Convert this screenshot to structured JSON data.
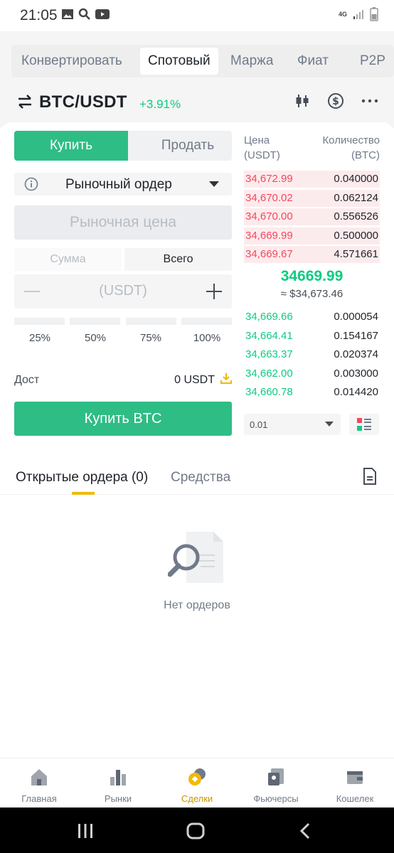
{
  "status_bar": {
    "time": "21:05",
    "network": "4G"
  },
  "top_tabs": [
    "Конвертировать",
    "Спотовый",
    "Маржа",
    "Фиат",
    "P2P"
  ],
  "pair": {
    "name": "BTC/USDT",
    "change": "+3.91%"
  },
  "trade": {
    "buy_label": "Купить",
    "sell_label": "Продать",
    "order_type": "Рыночный ордер",
    "market_price_label": "Рыночная цена",
    "amount_tabs": [
      "Сумма",
      "Всего"
    ],
    "amount_placeholder": "(USDT)",
    "percentages": [
      "25%",
      "50%",
      "75%",
      "100%"
    ],
    "available_label": "Дост",
    "available_value": "0 USDT",
    "buy_button": "Купить BTC"
  },
  "order_book": {
    "price_header": [
      "Цена",
      "(USDT)"
    ],
    "qty_header": [
      "Количество",
      "(BTC)"
    ],
    "asks": [
      {
        "price": "34,672.99",
        "qty": "0.040000"
      },
      {
        "price": "34,670.02",
        "qty": "0.062124"
      },
      {
        "price": "34,670.00",
        "qty": "0.556526"
      },
      {
        "price": "34,669.99",
        "qty": "0.500000"
      },
      {
        "price": "34,669.67",
        "qty": "4.571661"
      }
    ],
    "last_price": "34669.99",
    "last_price_usd": "≈ $34,673.46",
    "bids": [
      {
        "price": "34,669.66",
        "qty": "0.000054"
      },
      {
        "price": "34,664.41",
        "qty": "0.154167"
      },
      {
        "price": "34,663.37",
        "qty": "0.020374"
      },
      {
        "price": "34,662.00",
        "qty": "0.003000"
      },
      {
        "price": "34,660.78",
        "qty": "0.014420"
      }
    ],
    "depth": "0.01"
  },
  "orders": {
    "open_tab": "Открытые ордера (0)",
    "assets_tab": "Средства",
    "empty_text": "Нет ордеров"
  },
  "bottom_nav": [
    "Главная",
    "Рынки",
    "Сделки",
    "Фьючерсы",
    "Кошелек"
  ],
  "colors": {
    "green": "#2ebd85",
    "red": "#f6465d",
    "yellow": "#f0b90b"
  }
}
